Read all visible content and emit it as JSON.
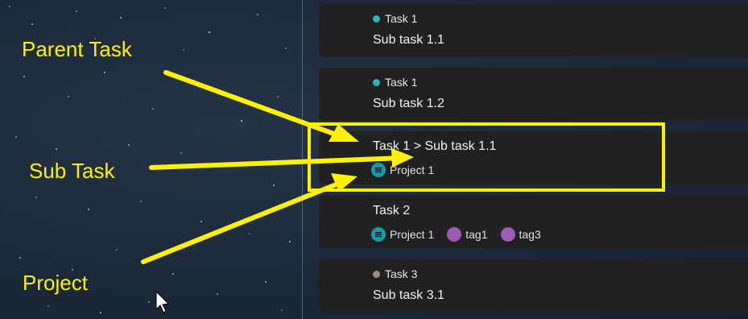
{
  "annotations": {
    "parent_task": "Parent Task",
    "sub_task": "Sub Task",
    "project": "Project"
  },
  "cards": [
    {
      "parent": "Task 1",
      "parent_color": "#2bb3c0",
      "title": "Sub task 1.1"
    },
    {
      "parent": "Task 1",
      "parent_color": "#2bb3c0",
      "title": "Sub task 1.2"
    },
    {
      "title": "Task 1 > Sub task 1.1",
      "project": "Project 1"
    },
    {
      "title": "Task 2",
      "project": "Project 1",
      "tags": [
        "tag1",
        "tag3"
      ]
    },
    {
      "parent": "Task 3",
      "parent_color": "#a08a80",
      "title": "Sub task 3.1"
    }
  ],
  "colors": {
    "highlight": "#fff200",
    "project_icon": "#1e98a8",
    "tag": "#9c5bb5",
    "card_bg": "#212121"
  },
  "icons": [
    "list-icon",
    "mouse-pointer-icon",
    "arrow-icon"
  ]
}
